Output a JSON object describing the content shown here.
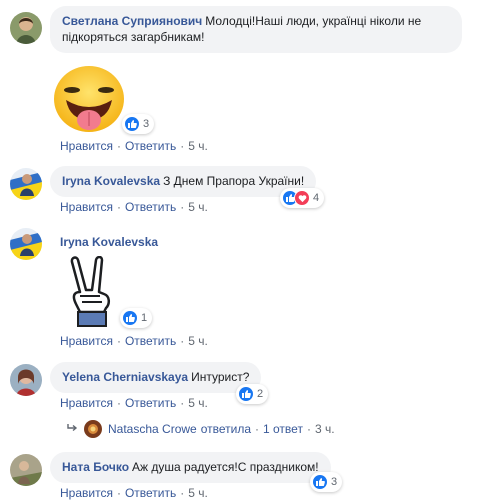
{
  "comments": [
    {
      "author": "Светлана Суприянович",
      "text": "Молодці!Наші люди, українці ніколи не підкоряться загарбникам!",
      "reaction_count": "3",
      "like": "Нравится",
      "reply": "Ответить",
      "time": "5 ч."
    },
    {
      "author": "Iryna Kovalevska",
      "text": "З Днем Прапора України!",
      "reaction_count": "4",
      "like": "Нравится",
      "reply": "Ответить",
      "time": "5 ч."
    },
    {
      "author": "Iryna Kovalevska",
      "text": "",
      "reaction_count": "1",
      "like": "Нравится",
      "reply": "Ответить",
      "time": "5 ч."
    },
    {
      "author": "Yelena Cherniavskaya",
      "text": "Интурист?",
      "reaction_count": "2",
      "like": "Нравится",
      "reply": "Ответить",
      "time": "5 ч."
    },
    {
      "author": "Ната Бочко",
      "text": "Аж душа радуется!С праздником!",
      "reaction_count": "3",
      "like": "Нравится",
      "reply": "Ответить",
      "time": "5 ч."
    }
  ],
  "reply_summary": {
    "author": "Natascha Crowe",
    "action": "ответила",
    "count": "1 ответ",
    "time": "3 ч."
  },
  "colors": {
    "link": "#385898",
    "bubble": "#f2f3f5",
    "like_blue": "#1877f2",
    "love_red": "#f33e58",
    "muted": "#606770"
  },
  "icons": [
    "tongue-emoji-sticker",
    "victory-hand-sticker",
    "like-icon",
    "love-icon",
    "reply-arrow-icon"
  ]
}
